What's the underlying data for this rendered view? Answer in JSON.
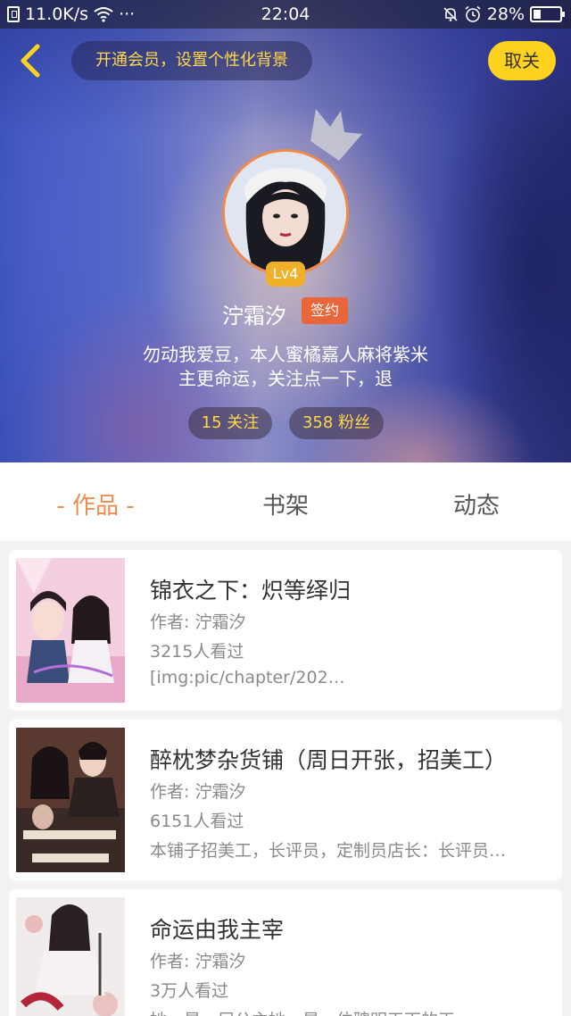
{
  "status_bar": {
    "speed": "11.0K/s",
    "dots": "···",
    "time": "22:04",
    "battery": "28%"
  },
  "header": {
    "vip_banner": "开通会员，设置个性化背景",
    "unfollow_label": "取关",
    "level": "Lv4",
    "username": "泞霜汐",
    "sign_badge": "签约",
    "bio_line1": "勿动我爱豆，本人蜜橘嘉人麻将紫米",
    "bio_line2": "主更命运，关注点一下，退",
    "following": "15 关注",
    "fans": "358 粉丝"
  },
  "tabs": [
    {
      "label": "- 作品 -"
    },
    {
      "label": "书架"
    },
    {
      "label": "动态"
    }
  ],
  "books": [
    {
      "title": "锦衣之下：炽等绎归",
      "author": "作者: 泞霜汐",
      "views": "3215人看过",
      "desc": "[img:pic/chapter/202…"
    },
    {
      "title": "醉枕梦杂货铺（周日开张，招美工）",
      "author": "作者: 泞霜汐",
      "views": "6151人看过",
      "desc": "本铺子招美工，长评员，定制员店长：长评员…"
    },
    {
      "title": "命运由我主宰",
      "author": "作者: 泞霜汐",
      "views": "3万人看过",
      "desc": "她，是一届公主她，是一位聰明天下的王"
    }
  ],
  "colors": {
    "accent": "#f08a4a",
    "vip_text": "#ffd84a",
    "unfollow_bg": "#ffd21f",
    "sign_badge_bg": "#e8663a",
    "level_badge_bg": "#f0b02a"
  }
}
